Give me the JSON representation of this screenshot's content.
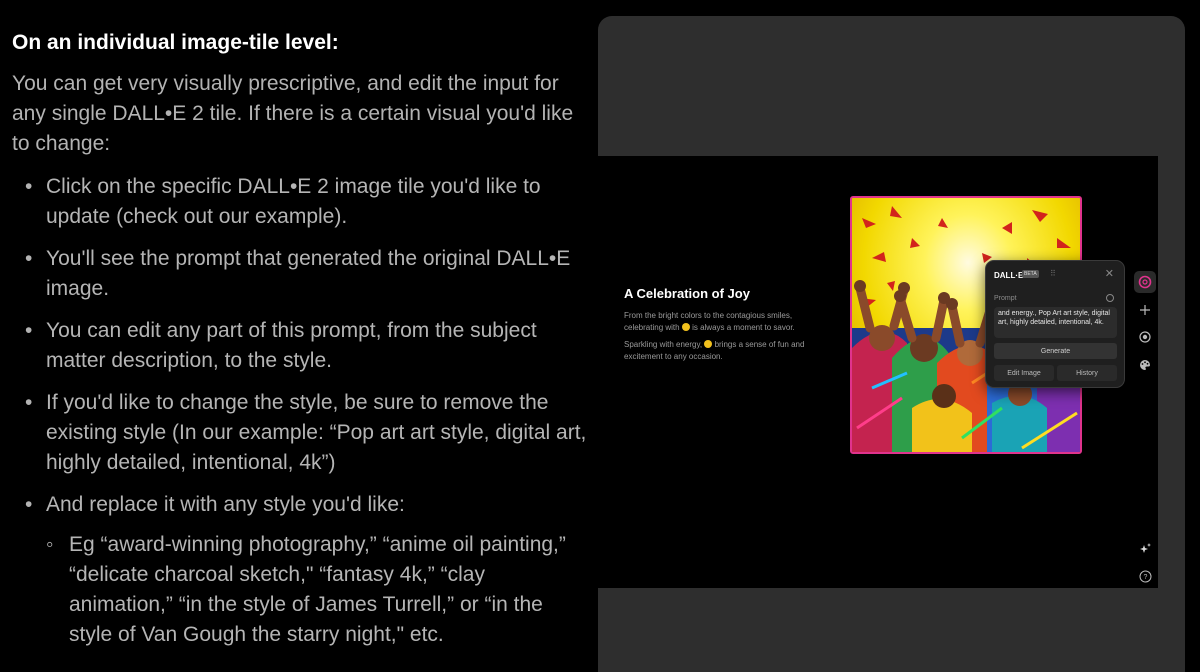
{
  "article": {
    "heading": "On an individual image-tile level:",
    "intro": "You can get very visually prescriptive, and edit the input for any single DALL•E 2 tile. If there is a certain visual you'd like to change:",
    "bullets": [
      "Click on the specific DALL•E 2 image tile you'd like to update (check out our example).",
      "You'll see the prompt that generated the original DALL•E image.",
      "You can edit any part of this prompt, from the subject matter description, to the style.",
      "If you'd like to change the style, be sure to remove the existing style (In our example: “Pop art art style, digital art, highly detailed, intentional, 4k”)",
      "And replace it with any style you'd like:"
    ],
    "sub_bullets": [
      "Eg “award-winning photography,” “anime oil painting,” “delicate charcoal sketch,\" “fantasy 4k,” “clay animation,” “in the style of James Turrell,” or “in the style of Van Gough the starry night,\" etc."
    ]
  },
  "card": {
    "title": "A Celebration of Joy",
    "desc1_a": "From the bright colors to the contagious smiles, celebrating with",
    "desc1_b": "is always a moment to savor.",
    "desc2_a": "Sparkling with energy,",
    "desc2_b": "brings a sense of fun and excitement to any occasion."
  },
  "dalle": {
    "title": "DALL·E",
    "badge": "BETA",
    "prompt_label": "Prompt",
    "prompt_value": "and energy., Pop Art art style, digital art, highly detailed, intentional, 4k.",
    "generate_label": "Generate",
    "edit_label": "Edit Image",
    "history_label": "History"
  },
  "colors": {
    "accent_pink": "#e0338d",
    "panel_bg": "#2e2e2e",
    "canvas_bg": "#000000"
  },
  "icons": [
    "dalle-logo-icon",
    "plus-icon",
    "record-icon",
    "palette-icon",
    "sparkle-icon",
    "help-icon",
    "close-icon"
  ]
}
